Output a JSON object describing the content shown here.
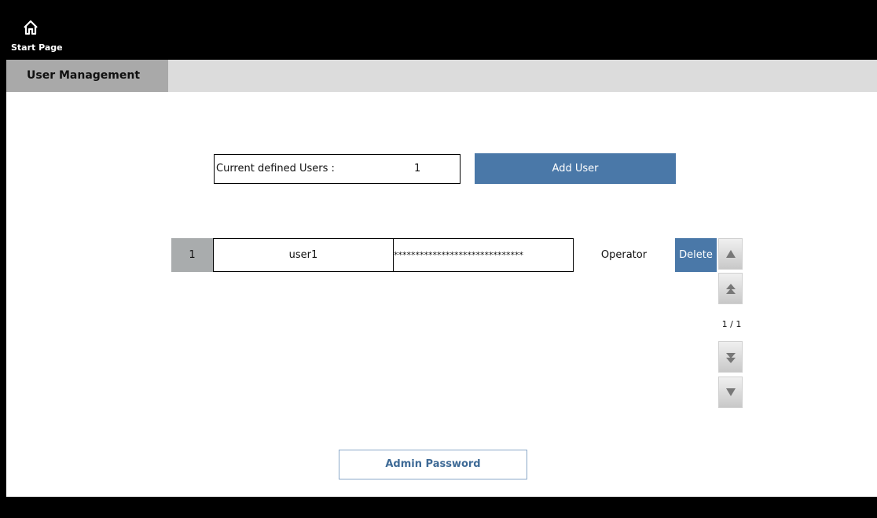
{
  "header": {
    "home_label": "Start Page",
    "home_icon": "home-icon"
  },
  "tabs": {
    "active_label": "User Management"
  },
  "users": {
    "count_label": "Current defined Users :",
    "count_value": "1",
    "add_label": "Add User"
  },
  "rows": [
    {
      "index": "1",
      "name": "user1",
      "password": "******************************",
      "role": "Operator",
      "delete_label": "Delete"
    }
  ],
  "pager": {
    "indicator": "1 / 1",
    "icons": [
      "arrow-up-icon",
      "arrow-double-up-icon",
      "arrow-double-down-icon",
      "arrow-down-icon"
    ]
  },
  "footer": {
    "admin_password_label": "Admin Password"
  },
  "colors": {
    "accent_blue": "#4a78a8",
    "active_tab": "#a9a9a9",
    "tabstrip": "#dcdcdc"
  }
}
